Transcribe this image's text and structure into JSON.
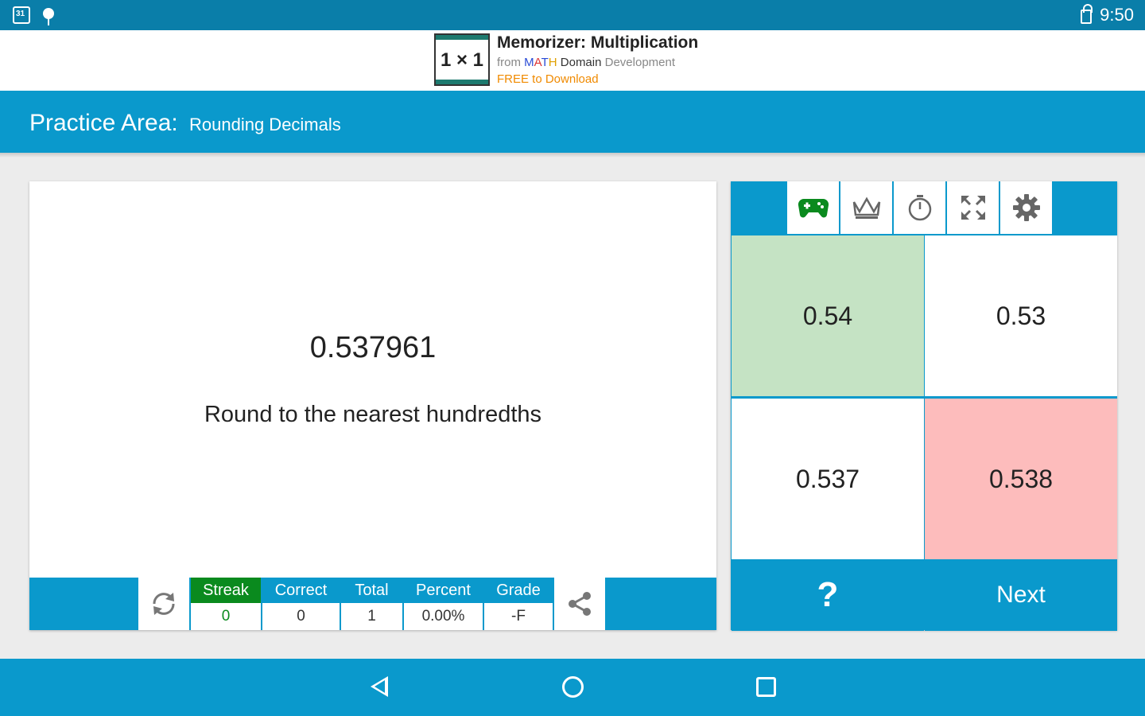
{
  "status_bar": {
    "time": "9:50"
  },
  "ad": {
    "logo_text": "1 × 1",
    "title": "Memorizer: Multiplication",
    "from": "from",
    "brand_m": "M",
    "brand_a": "A",
    "brand_t": "T",
    "brand_h": "H",
    "brand_rest": "Domain",
    "development": "Development",
    "free": "FREE to Download"
  },
  "header": {
    "title": "Practice Area:",
    "subtitle": "Rounding Decimals"
  },
  "question": {
    "number": "0.537961",
    "instruction": "Round to the nearest  hundredths"
  },
  "stats": [
    {
      "label": "Streak",
      "value": "0"
    },
    {
      "label": "Correct",
      "value": "0"
    },
    {
      "label": "Total",
      "value": "1"
    },
    {
      "label": "Percent",
      "value": "0.00%"
    },
    {
      "label": "Grade",
      "value": "-F"
    }
  ],
  "answers": [
    {
      "value": "0.54",
      "state": "correct"
    },
    {
      "value": "0.53",
      "state": "neutral"
    },
    {
      "value": "0.537",
      "state": "neutral"
    },
    {
      "value": "0.538",
      "state": "wrong"
    }
  ],
  "actions": {
    "help": "?",
    "next": "Next"
  },
  "colors": {
    "primary": "#0a99cc",
    "status_bar": "#0a7ea9",
    "correct": "#c5e3c4",
    "wrong": "#fdbcbc",
    "streak": "#0a8a1e"
  },
  "icons": [
    "gamepad-icon",
    "crown-icon",
    "stopwatch-icon",
    "fullscreen-icon",
    "gear-icon",
    "refresh-icon",
    "share-icon"
  ]
}
